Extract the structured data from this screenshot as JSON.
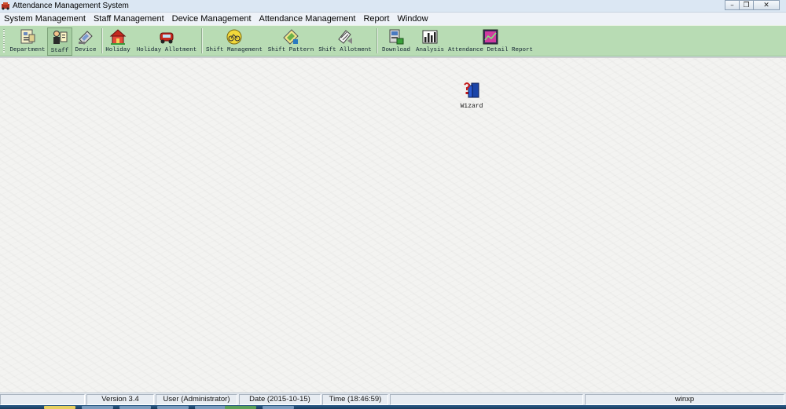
{
  "window": {
    "title": "Attendance Management System",
    "buttons": {
      "minimize": "–",
      "restore": "❐",
      "close": "✕"
    }
  },
  "menu": [
    "System Management",
    "Staff Management",
    "Device Management",
    "Attendance Management",
    "Report",
    "Window"
  ],
  "toolbar": {
    "department": "Department",
    "staff": "Staff",
    "device": "Device",
    "holiday": "Holiday",
    "holiday_allotment": "Holiday Allotment",
    "shift_management": "Shift Management",
    "shift_pattern": "Shift Pattern",
    "shift_allotment": "Shift Allotment",
    "download": "Download",
    "analysis": "Analysis",
    "attendance_detail_report": "Attendance Detail Report"
  },
  "desktop": {
    "wizard_label": "Wizard"
  },
  "status": {
    "version": "Version 3.4",
    "user": "User (Administrator)",
    "date": "Date (2015-10-15)",
    "time": "Time (18:46:59)",
    "host": "winxp"
  }
}
